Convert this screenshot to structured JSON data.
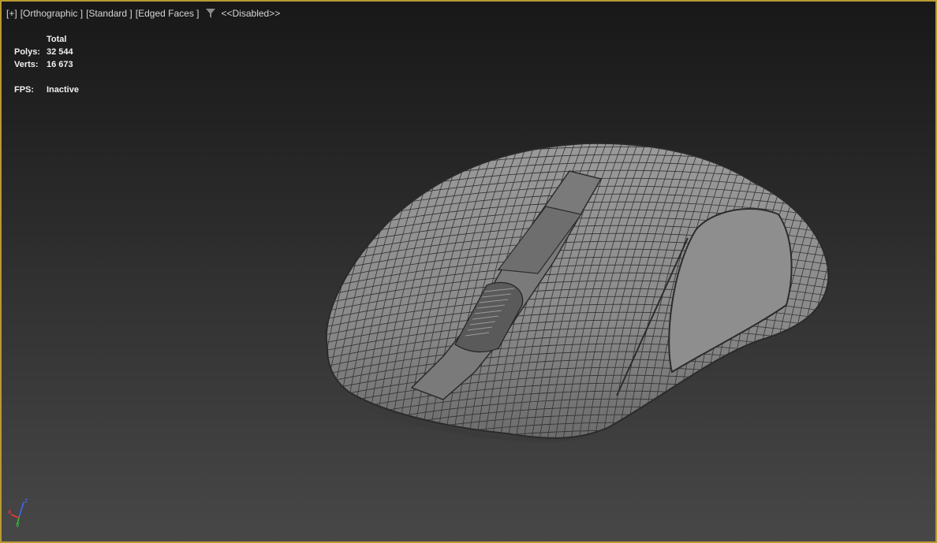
{
  "viewport": {
    "menu": {
      "plus": "[+]",
      "view": "[Orthographic ]",
      "shading": "[Standard ]",
      "display": "[Edged Faces ]",
      "filter_state": "<<Disabled>>"
    },
    "stats": {
      "header": "Total",
      "polys_label": "Polys:",
      "polys_value": "32 544",
      "verts_label": "Verts:",
      "verts_value": "16 673",
      "fps_label": "FPS:",
      "fps_value": "Inactive"
    },
    "gizmo": {
      "x": "x",
      "y": "y",
      "z": "z"
    },
    "colors": {
      "border": "#b79a31",
      "mesh": "#8d8d8d",
      "wire": "#2c2c2c"
    }
  }
}
